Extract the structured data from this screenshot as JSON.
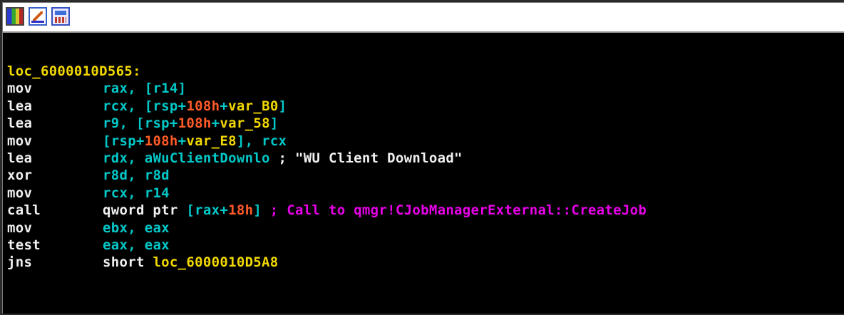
{
  "toolbar": {
    "icons": [
      "graph-view-icon",
      "edit-icon",
      "proxy-view-icon"
    ]
  },
  "listing": {
    "label": "loc_6000010D565:",
    "lines": [
      {
        "mnemonic": "mov",
        "tokens": [
          [
            "reg",
            "rax"
          ],
          [
            "punct",
            ", ["
          ],
          [
            "reg",
            "r14"
          ],
          [
            "punct",
            "]"
          ]
        ]
      },
      {
        "mnemonic": "lea",
        "tokens": [
          [
            "reg",
            "rcx"
          ],
          [
            "punct",
            ", [rsp+"
          ],
          [
            "num",
            "108h"
          ],
          [
            "punct",
            "+"
          ],
          [
            "var",
            "var_B0"
          ],
          [
            "punct",
            "]"
          ]
        ]
      },
      {
        "mnemonic": "lea",
        "tokens": [
          [
            "reg",
            "r9"
          ],
          [
            "punct",
            ", [rsp+"
          ],
          [
            "num",
            "108h"
          ],
          [
            "punct",
            "+"
          ],
          [
            "var",
            "var_58"
          ],
          [
            "punct",
            "]"
          ]
        ]
      },
      {
        "mnemonic": "mov",
        "tokens": [
          [
            "punct",
            "[rsp+"
          ],
          [
            "num",
            "108h"
          ],
          [
            "punct",
            "+"
          ],
          [
            "var",
            "var_E8"
          ],
          [
            "punct",
            "], "
          ],
          [
            "reg",
            "rcx"
          ]
        ]
      },
      {
        "mnemonic": "lea",
        "tokens": [
          [
            "reg",
            "rdx"
          ],
          [
            "punct",
            ", "
          ],
          [
            "plain",
            "aWuClientDownlo"
          ],
          [
            "str",
            " ; \"WU Client Download\""
          ]
        ]
      },
      {
        "mnemonic": "xor",
        "tokens": [
          [
            "reg",
            "r8d"
          ],
          [
            "punct",
            ", "
          ],
          [
            "reg",
            "r8d"
          ]
        ]
      },
      {
        "mnemonic": "mov",
        "tokens": [
          [
            "reg",
            "rcx"
          ],
          [
            "punct",
            ", "
          ],
          [
            "reg",
            "r14"
          ]
        ]
      },
      {
        "mnemonic": "call",
        "tokens": [
          [
            "str",
            "qword ptr "
          ],
          [
            "punct",
            "[rax+"
          ],
          [
            "num",
            "18h"
          ],
          [
            "punct",
            "]"
          ],
          [
            "cmt-call",
            " ; Call to qmgr!CJobManagerExternal::CreateJob"
          ]
        ]
      },
      {
        "mnemonic": "mov",
        "tokens": [
          [
            "reg",
            "ebx"
          ],
          [
            "punct",
            ", "
          ],
          [
            "reg",
            "eax"
          ]
        ]
      },
      {
        "mnemonic": "test",
        "tokens": [
          [
            "reg",
            "eax"
          ],
          [
            "punct",
            ", "
          ],
          [
            "reg",
            "eax"
          ]
        ]
      },
      {
        "mnemonic": "jns",
        "tokens": [
          [
            "str",
            "short "
          ],
          [
            "lbl",
            "loc_6000010D5A8"
          ]
        ]
      }
    ]
  },
  "colors": {
    "background": "#000000",
    "label": "#f2d800",
    "mnemonic": "#f0f0f0",
    "operand": "#00c8c8",
    "number": "#ff5a28",
    "comment_call": "#e800e8"
  }
}
